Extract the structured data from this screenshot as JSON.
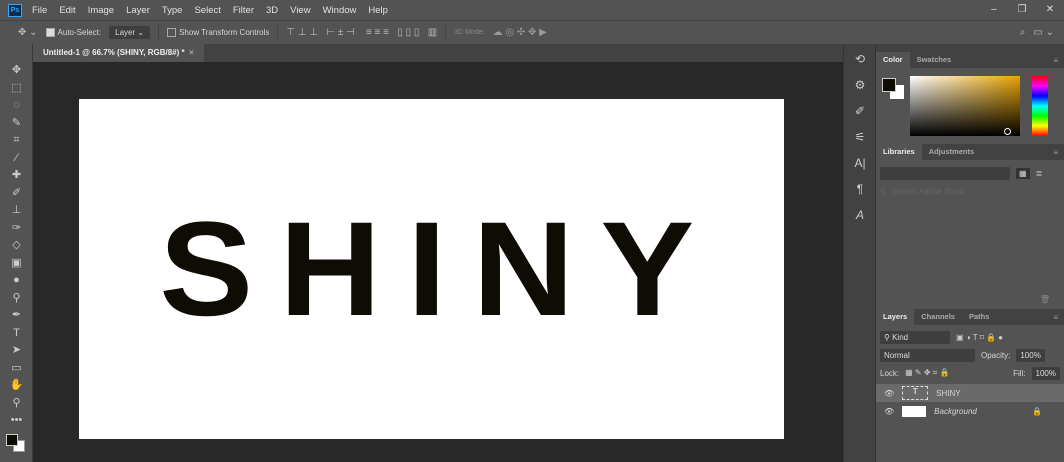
{
  "app": {
    "logo": "Ps",
    "menu": [
      "File",
      "Edit",
      "Image",
      "Layer",
      "Type",
      "Select",
      "Filter",
      "3D",
      "View",
      "Window",
      "Help"
    ],
    "window_controls": [
      "–",
      "❐",
      "✕"
    ]
  },
  "options": {
    "auto_select_label": "Auto-Select:",
    "auto_select_checked": true,
    "auto_select_target": "Layer",
    "show_transform_label": "Show Transform Controls",
    "show_transform_checked": false,
    "mode_3d_label": "3D Mode:"
  },
  "document": {
    "tab_title": "Untitled-1 @ 66.7% (SHINY, RGB/8#) *",
    "close": "×",
    "canvas_text": "SHINY"
  },
  "color_panel": {
    "tabs": [
      "Color",
      "Swatches"
    ],
    "foreground": "#0f0c06",
    "background": "#ffffff",
    "hue_color": "#e8a300"
  },
  "libraries_panel": {
    "tabs": [
      "Libraries",
      "Adjustments"
    ],
    "search_placeholder": "Search Adobe Stock"
  },
  "layers_panel": {
    "tabs": [
      "Layers",
      "Channels",
      "Paths"
    ],
    "filter": "Kind",
    "blend_mode": "Normal",
    "opacity_label": "Opacity:",
    "opacity": "100%",
    "lock_label": "Lock:",
    "fill_label": "Fill:",
    "fill": "100%",
    "layers": [
      {
        "name": "SHINY",
        "type": "text",
        "selected": true
      },
      {
        "name": "Background",
        "type": "pixel",
        "locked": true
      }
    ]
  }
}
